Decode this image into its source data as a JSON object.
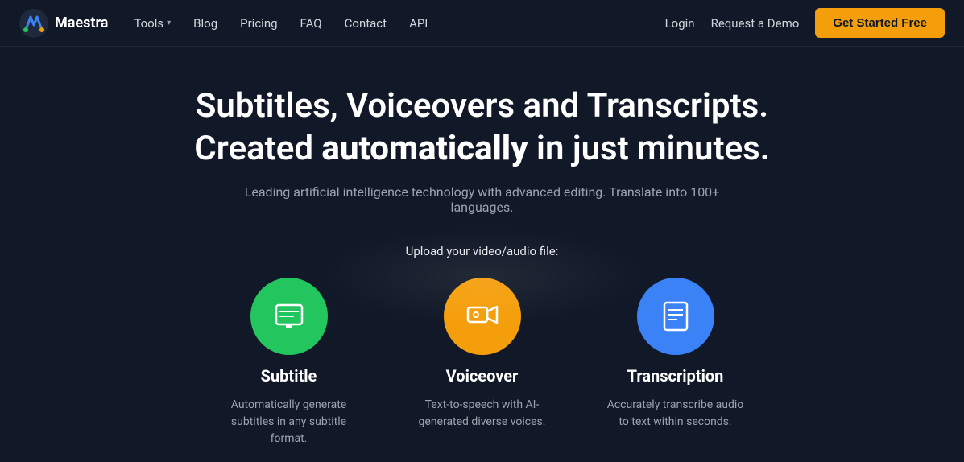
{
  "nav": {
    "logo_text": "Maestra",
    "tools_label": "Tools",
    "blog_label": "Blog",
    "pricing_label": "Pricing",
    "faq_label": "FAQ",
    "contact_label": "Contact",
    "api_label": "API",
    "login_label": "Login",
    "demo_label": "Request a Demo",
    "cta_label": "Get Started Free"
  },
  "hero": {
    "title_line1": "Subtitles, Voiceovers and Transcripts.",
    "title_line2_normal": "Created ",
    "title_line2_bold": "automatically",
    "title_line2_end": " in just minutes.",
    "subtitle": "Leading artificial intelligence technology with advanced editing. Translate into 100+ languages.",
    "upload_label": "Upload your video/audio file:"
  },
  "cards": [
    {
      "id": "subtitle",
      "title": "Subtitle",
      "description": "Automatically generate subtitles in any subtitle format.",
      "icon_color": "#22c55e",
      "icon_type": "subtitle"
    },
    {
      "id": "voiceover",
      "title": "Voiceover",
      "description": "Text-to-speech with AI-generated diverse voices.",
      "icon_color": "#f59e0b",
      "icon_type": "voiceover"
    },
    {
      "id": "transcription",
      "title": "Transcription",
      "description": "Accurately transcribe audio to text within seconds.",
      "icon_color": "#3b82f6",
      "icon_type": "transcription"
    }
  ]
}
